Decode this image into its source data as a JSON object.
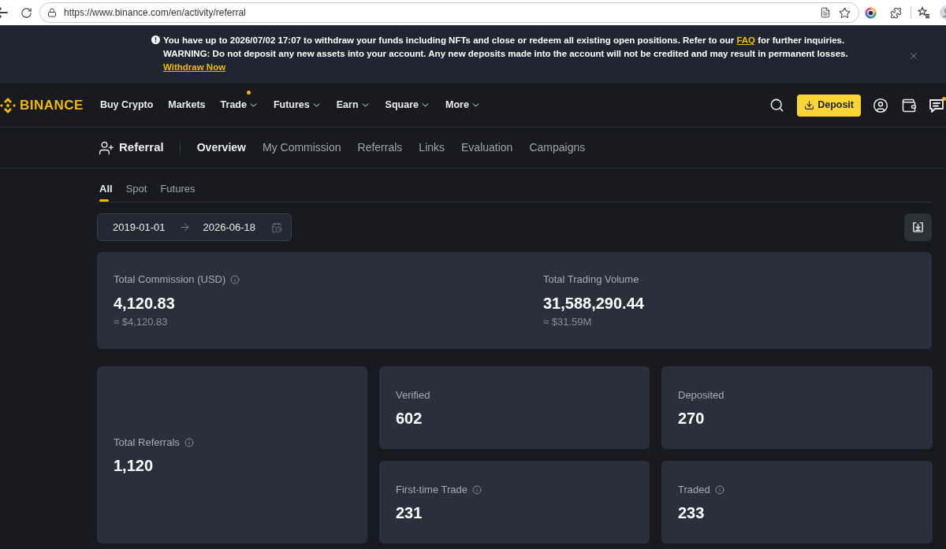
{
  "browser": {
    "url": "https://www.binance.com/en/activity/referral"
  },
  "banner": {
    "message_start": "You have up to 2026/07/02 17:07 to withdraw your funds including NFTs and close or redeem all existing open positions. Refer to our",
    "faq_link": "FAQ",
    "message_end": "for further inquiries.",
    "warning": "**WARNING:** Do not deposit any new assets into your account. Any new deposits made into the account will not be credited and may result in permanent losses.",
    "action_link": "Withdraw Now"
  },
  "nav": {
    "logo": "BINANCE",
    "items": [
      {
        "label": "Buy Crypto",
        "dropdown": false,
        "dot": false
      },
      {
        "label": "Markets",
        "dropdown": false,
        "dot": false
      },
      {
        "label": "Trade",
        "dropdown": true,
        "dot": true
      },
      {
        "label": "Futures",
        "dropdown": true,
        "dot": false
      },
      {
        "label": "Earn",
        "dropdown": true,
        "dot": false
      },
      {
        "label": "Square",
        "dropdown": true,
        "dot": false
      },
      {
        "label": "More",
        "dropdown": true,
        "dot": false
      }
    ],
    "deposit_button": "Deposit"
  },
  "subnav": {
    "title": "Referral",
    "tabs": [
      {
        "label": "Overview",
        "selected": true
      },
      {
        "label": "My Commission",
        "selected": false
      },
      {
        "label": "Referrals",
        "selected": false
      },
      {
        "label": "Links",
        "selected": false
      },
      {
        "label": "Evaluation",
        "selected": false
      },
      {
        "label": "Campaigns",
        "selected": false
      }
    ]
  },
  "market_tabs": [
    {
      "label": "All",
      "selected": true
    },
    {
      "label": "Spot",
      "selected": false
    },
    {
      "label": "Futures",
      "selected": false
    }
  ],
  "date_range": {
    "start": "2019-01-01",
    "end": "2026-06-18"
  },
  "summary": [
    {
      "label": "Total Commission (USD)",
      "info": true,
      "value": "4,120.83",
      "approx": "≈ $4,120.83"
    },
    {
      "label": "Total Trading Volume",
      "info": false,
      "value": "31,588,290.44",
      "approx": "≈ $31.59M"
    }
  ],
  "referrals_total": {
    "label": "Total Referrals",
    "info": true,
    "value": "1,120"
  },
  "referral_stats": [
    {
      "label": "Verified",
      "info": false,
      "value": "602"
    },
    {
      "label": "Deposited",
      "info": false,
      "value": "270"
    },
    {
      "label": "First-time Trade",
      "info": true,
      "value": "231"
    },
    {
      "label": "Traded",
      "info": true,
      "value": "233"
    }
  ]
}
